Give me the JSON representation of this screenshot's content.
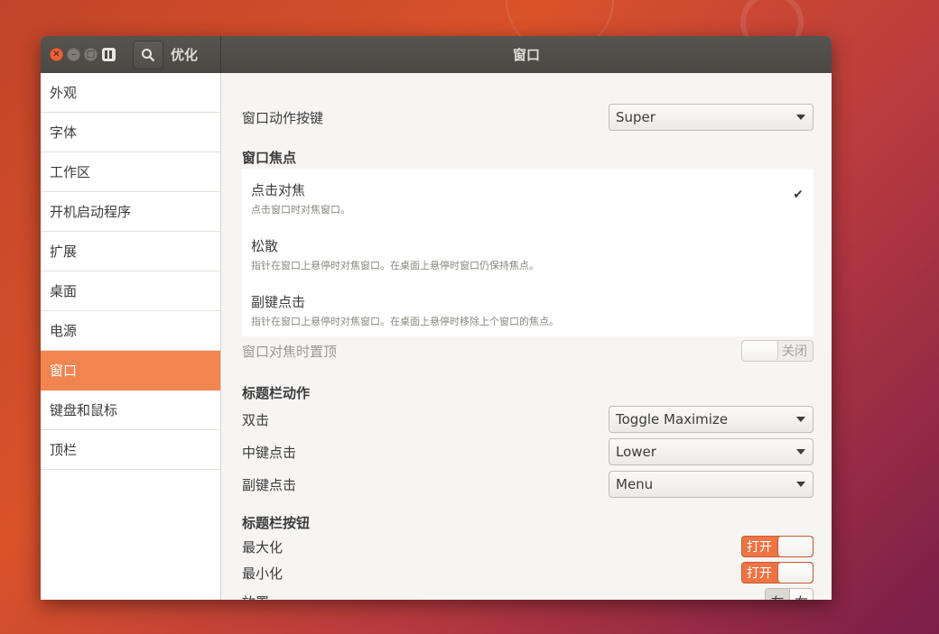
{
  "titlebar": {
    "app_title": "优化",
    "window_title": "窗口"
  },
  "sidebar": {
    "items": [
      {
        "label": "外观"
      },
      {
        "label": "字体"
      },
      {
        "label": "工作区"
      },
      {
        "label": "开机启动程序"
      },
      {
        "label": "扩展"
      },
      {
        "label": "桌面"
      },
      {
        "label": "电源"
      },
      {
        "label": "窗口",
        "active": true
      },
      {
        "label": "键盘和鼠标"
      },
      {
        "label": "顶栏"
      }
    ]
  },
  "main": {
    "action_key": {
      "label": "窗口动作按键",
      "value": "Super"
    },
    "focus_section": {
      "title": "窗口焦点",
      "options": [
        {
          "title": "点击对焦",
          "desc": "点击窗口时对焦窗口。",
          "selected": true
        },
        {
          "title": "松散",
          "desc": "指针在窗口上悬停时对焦窗口。在桌面上悬停时窗口仍保持焦点。"
        },
        {
          "title": "副键点击",
          "desc": "指针在窗口上悬停时对焦窗口。在桌面上悬停时移除上个窗口的焦点。"
        }
      ]
    },
    "raise_on_focus": {
      "label": "窗口对焦时置顶",
      "state": "关闭"
    },
    "titlebar_actions": {
      "title": "标题栏动作",
      "double_click": {
        "label": "双击",
        "value": "Toggle Maximize"
      },
      "middle_click": {
        "label": "中键点击",
        "value": "Lower"
      },
      "secondary_click": {
        "label": "副键点击",
        "value": "Menu"
      }
    },
    "titlebar_buttons": {
      "title": "标题栏按钮",
      "maximize": {
        "label": "最大化",
        "state": "打开"
      },
      "minimize": {
        "label": "最小化",
        "state": "打开"
      },
      "placement": {
        "label": "放置",
        "left": "左",
        "right": "右",
        "selected": "左"
      }
    }
  },
  "colors": {
    "accent": "#f08550",
    "switch_on": "#ee7444",
    "titlebar": "#4f4d48"
  }
}
